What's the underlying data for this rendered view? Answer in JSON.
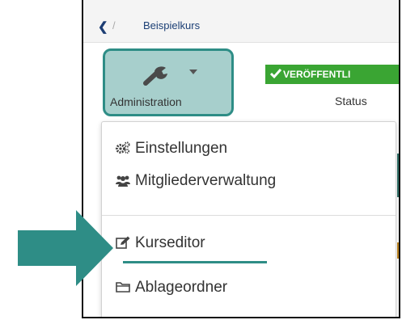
{
  "breadcrumb": {
    "back_glyph": "❮",
    "separator": "/",
    "course": "Beispielkurs"
  },
  "toolbar": {
    "admin_button": {
      "icon": "wrench-icon",
      "caret": "chevron-down-icon",
      "label": "Administration"
    },
    "status": {
      "badge_icon": "check-icon",
      "badge_text": "VERÖFFENTLI",
      "label": "Status",
      "badge_color": "#3aa533"
    }
  },
  "admin_menu": {
    "items": [
      {
        "label": "Einstellungen",
        "icon": "gears-icon"
      },
      {
        "label": "Mitgliederverwaltung",
        "icon": "users-icon"
      },
      {
        "label": "Kurseditor",
        "icon": "edit-icon",
        "highlighted": true
      },
      {
        "label": "Ablageordner",
        "icon": "folder-icon"
      }
    ]
  },
  "annotation": {
    "pointer": "arrow-right-icon",
    "accent_color": "#2e8d86",
    "highlight_fill": "#a7cfcc"
  }
}
